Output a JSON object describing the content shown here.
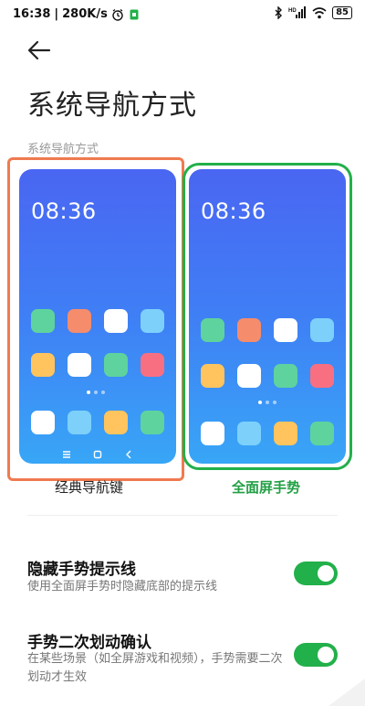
{
  "status_bar": {
    "time": "16:38",
    "speed": "280K/s",
    "network": "HD",
    "battery": "85"
  },
  "header": {
    "title": "系统导航方式",
    "section": "系统导航方式"
  },
  "options": [
    {
      "label": "经典导航键",
      "selected": false,
      "accent": "#f07a50"
    },
    {
      "label": "全面屏手势",
      "selected": true,
      "accent": "#22b04a"
    }
  ],
  "preview": {
    "clock": "08:36",
    "icon_colors": [
      "#5fd39d",
      "#f58c6b",
      "#ffffff",
      "#7dd0fa",
      "#ffc45e",
      "#ffffff",
      "#5fd39d",
      "#f96f82",
      "#ffffff",
      "#7dd0fa",
      "#ffc45e",
      "#5fd39d"
    ]
  },
  "settings": [
    {
      "title": "隐藏手势提示线",
      "subtitle": "使用全面屏手势时隐藏底部的提示线",
      "enabled": true
    },
    {
      "title": "手势二次划动确认",
      "subtitle": "在某些场景（如全屏游戏和视频），手势需要二次划动才生效",
      "enabled": true
    }
  ]
}
